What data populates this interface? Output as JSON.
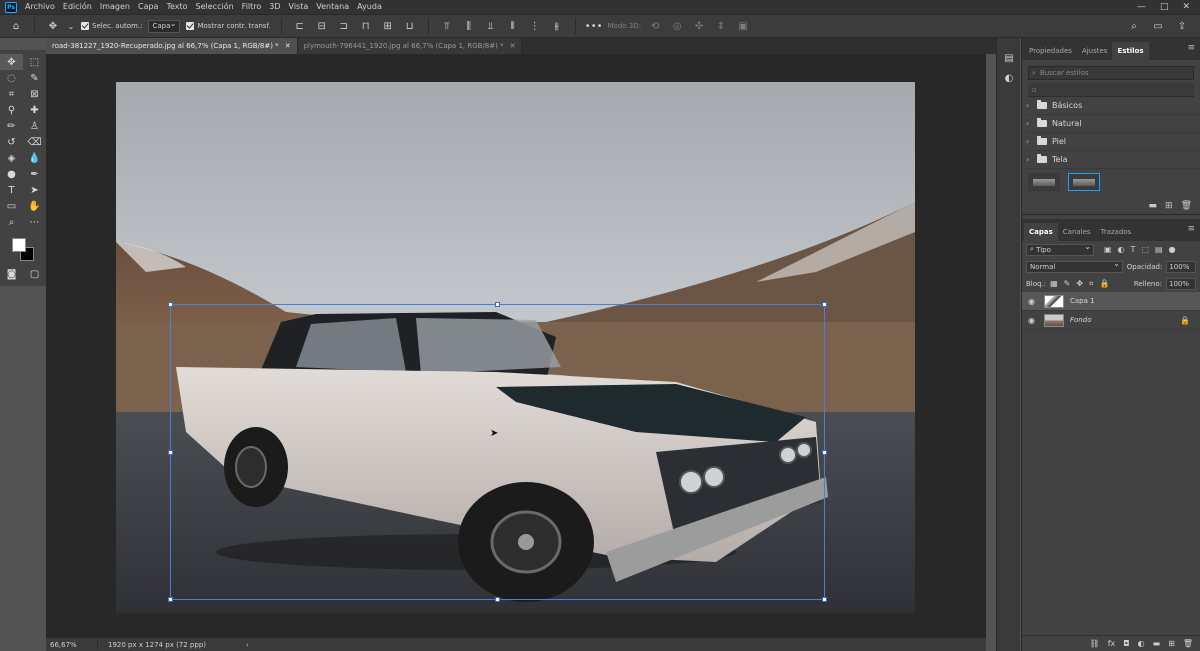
{
  "app": {
    "logo": "Ps"
  },
  "menu": [
    "Archivo",
    "Edición",
    "Imagen",
    "Capa",
    "Texto",
    "Selección",
    "Filtro",
    "3D",
    "Vista",
    "Ventana",
    "Ayuda"
  ],
  "window_controls": {
    "minimize": "—",
    "maximize": "□",
    "close": "✕"
  },
  "options_bar": {
    "auto_select_label": "Selec. autom.:",
    "auto_select_value": "Capa",
    "show_transform_label": "Mostrar contr. transf.",
    "more": "•••",
    "mode_3d_label": "Modo 3D:"
  },
  "document_tabs": [
    {
      "title": "road-381227_1920-Recuperado.jpg al 66,7% (Capa 1, RGB/8#) *",
      "close": "✕"
    },
    {
      "title": "plymouth-796441_1920.jpg al 66,7% (Capa 1, RGB/8#) *",
      "close": "✕"
    }
  ],
  "status_bar": {
    "zoom": "66,67%",
    "doc_info": "1920 px x 1274 px (72 ppp)",
    "arrow": "›"
  },
  "styles_panel": {
    "tabs": [
      "Propiedades",
      "Ajustes",
      "Estilos"
    ],
    "active_tab": "Estilos",
    "search_placeholder": "Buscar estilos",
    "groups": [
      "Básicos",
      "Natural",
      "Piel",
      "Tela"
    ]
  },
  "layers_panel": {
    "tabs": [
      "Capas",
      "Canales",
      "Trazados"
    ],
    "filter_kind": "Tipo",
    "blend_mode": "Normal",
    "opacity_label": "Opacidad:",
    "opacity_value": "100%",
    "lock_label": "Bloq.:",
    "fill_label": "Relleno:",
    "fill_value": "100%",
    "layers": [
      {
        "name": "Capa 1",
        "selected": true
      },
      {
        "name": "Fondo",
        "selected": false,
        "locked": true
      }
    ]
  },
  "colors": {
    "foreground": "#ffffff",
    "background": "#000000",
    "accent": "#1ea0ff"
  }
}
